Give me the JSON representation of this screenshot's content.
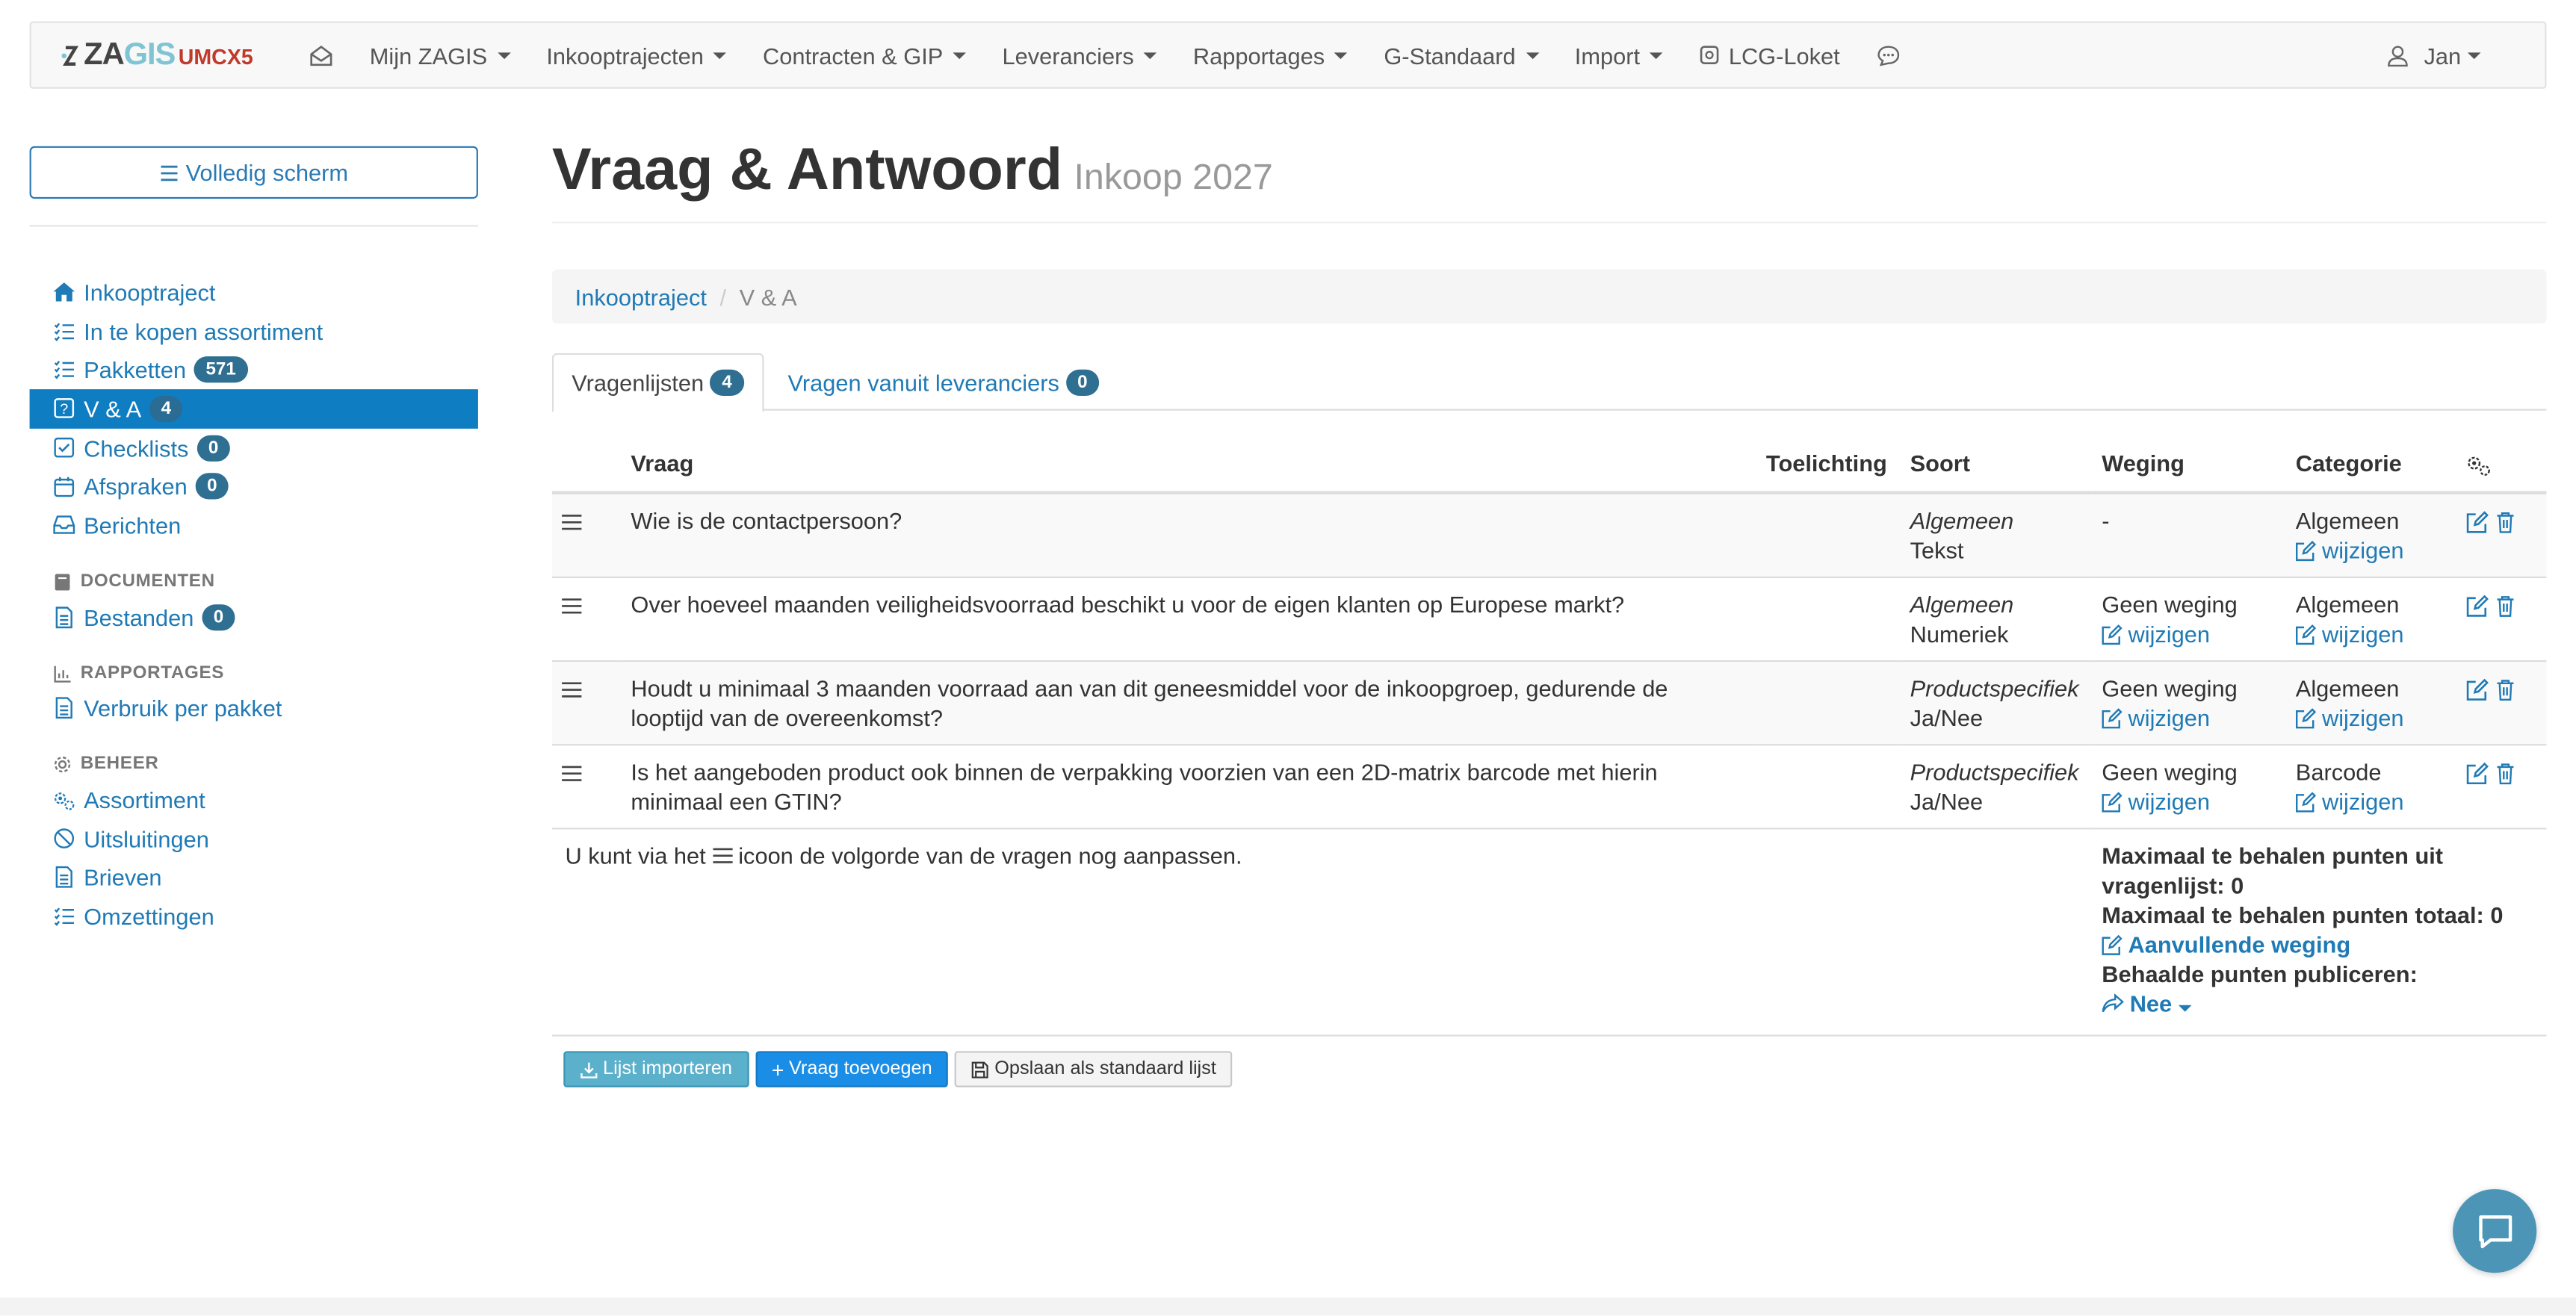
{
  "brand": {
    "part1": "ZA",
    "part2": "GIS",
    "part3": "UMCX5"
  },
  "nav": {
    "items": [
      {
        "label": "Mijn ZAGIS"
      },
      {
        "label": "Inkooptrajecten"
      },
      {
        "label": "Contracten & GIP"
      },
      {
        "label": "Leveranciers"
      },
      {
        "label": "Rapportages"
      },
      {
        "label": "G-Standaard"
      },
      {
        "label": "Import"
      }
    ],
    "lcg": "LCG-Loket",
    "user": "Jan"
  },
  "sidebar": {
    "fullscreen": "Volledig scherm",
    "items": [
      {
        "label": "Inkooptraject",
        "icon": "home-icon"
      },
      {
        "label": "In te kopen assortiment",
        "icon": "list-check-icon"
      },
      {
        "label": "Pakketten",
        "badge": "571",
        "icon": "list-check-icon"
      },
      {
        "label": "V & A",
        "badge": "4",
        "icon": "question-square-icon"
      },
      {
        "label": "Checklists",
        "badge": "0",
        "icon": "check-square-icon"
      },
      {
        "label": "Afspraken",
        "badge": "0",
        "icon": "calendar-icon"
      },
      {
        "label": "Berichten",
        "icon": "inbox-icon"
      }
    ],
    "section_docs": "DOCUMENTEN",
    "docs": [
      {
        "label": "Bestanden",
        "badge": "0"
      }
    ],
    "section_reports": "RAPPORTAGES",
    "reports": [
      {
        "label": "Verbruik per pakket"
      }
    ],
    "section_beheer": "BEHEER",
    "beheer": [
      {
        "label": "Assortiment"
      },
      {
        "label": "Uitsluitingen"
      },
      {
        "label": "Brieven"
      },
      {
        "label": "Omzettingen"
      }
    ]
  },
  "page": {
    "title": "Vraag & Antwoord",
    "subtitle": "Inkoop 2027"
  },
  "breadcrumb": {
    "link": "Inkooptraject",
    "current": "V & A"
  },
  "tabs": [
    {
      "label": "Vragenlijsten",
      "badge": "4"
    },
    {
      "label": "Vragen vanuit leveranciers",
      "badge": "0"
    }
  ],
  "table": {
    "headers": {
      "vraag": "Vraag",
      "toelichting": "Toelichting",
      "soort": "Soort",
      "weging": "Weging",
      "categorie": "Categorie"
    },
    "edit_label": "wijzigen",
    "rows": [
      {
        "vraag": "Wie is de contactpersoon?",
        "soort_type": "Algemeen",
        "soort_format": "Tekst",
        "weging": "-",
        "weging_edit": false,
        "categorie": "Algemeen"
      },
      {
        "vraag": "Over hoeveel maanden veiligheidsvoorraad beschikt u voor de eigen klanten op Europese markt?",
        "soort_type": "Algemeen",
        "soort_format": "Numeriek",
        "weging": "Geen weging",
        "weging_edit": true,
        "categorie": "Algemeen"
      },
      {
        "vraag": "Houdt u minimaal 3 maanden voorraad aan van dit geneesmiddel voor de inkoopgroep, gedurende de looptijd van de overeenkomst?",
        "soort_type": "Productspecifiek",
        "soort_format": "Ja/Nee",
        "weging": "Geen weging",
        "weging_edit": true,
        "categorie": "Algemeen"
      },
      {
        "vraag": "Is het aangeboden product ook binnen de verpakking voorzien van een 2D-matrix barcode met hierin minimaal een GTIN?",
        "soort_type": "Productspecifiek",
        "soort_format": "Ja/Nee",
        "weging": "Geen weging",
        "weging_edit": true,
        "categorie": "Barcode"
      }
    ],
    "footer_hint_pre": "U kunt via het",
    "footer_hint_post": "icoon de volgorde van de vragen nog aanpassen.",
    "max_list": "Maximaal te behalen punten uit vragenlijst: 0",
    "max_total": "Maximaal te behalen punten totaal: 0",
    "extra_weight": "Aanvullende weging",
    "publish_label": "Behaalde punten publiceren:",
    "publish_value": "Nee"
  },
  "buttons": {
    "import": "Lijst importeren",
    "add": "Vraag toevoegen",
    "save": "Opslaan als standaard lijst"
  }
}
